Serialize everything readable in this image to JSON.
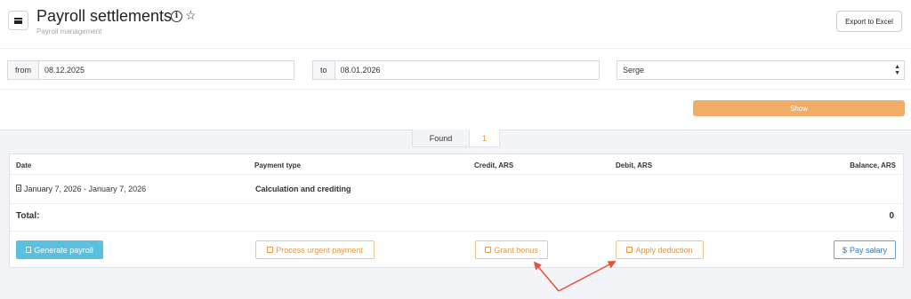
{
  "header": {
    "title": "Payroll settlements",
    "subtitle": "Payroll management",
    "export_label": "Export to Excel"
  },
  "filters": {
    "from_label": "from",
    "from_value": "08.12.2025",
    "to_label": "to",
    "to_value": "08.01.2026",
    "employee_selected": "Serge",
    "show_label": "Show"
  },
  "results": {
    "found_label": "Found",
    "found_count": "1"
  },
  "table": {
    "columns": [
      "Date",
      "Payment type",
      "Credit, ARS",
      "Debit, ARS",
      "Balance, ARS"
    ],
    "rows": [
      {
        "date": "January 7, 2026 - January 7, 2026",
        "payment_type": "Calculation and crediting",
        "credit": "",
        "debit": "",
        "balance": ""
      }
    ],
    "total_label": "Total:",
    "total_value": "0"
  },
  "actions": {
    "generate_payroll": "Generate payroll",
    "process_urgent_payment": "Process urgent payment",
    "grant_bonus": "Grant bonus",
    "apply_deduction": "Apply deduction",
    "pay_salary": "Pay salary"
  },
  "colors": {
    "accent_orange": "#f0ad68",
    "button_cyan": "#5bc0de",
    "button_blue": "#337ab7",
    "annotation_red": "#e8503a"
  }
}
